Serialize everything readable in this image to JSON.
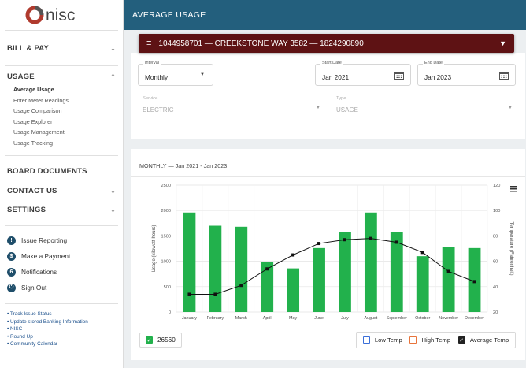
{
  "brand": {
    "logo_text": "nisc"
  },
  "header": {
    "title": "AVERAGE USAGE"
  },
  "account": {
    "label": "1044958701 — CREEKSTONE WAY 3582 — 1824290890"
  },
  "sidebar": {
    "bill_pay": "BILL & PAY",
    "usage": "USAGE",
    "usage_items": [
      "Average Usage",
      "Enter Meter Readings",
      "Usage Comparison",
      "Usage Explorer",
      "Usage Management",
      "Usage Tracking"
    ],
    "board_documents": "BOARD DOCUMENTS",
    "contact_us": "CONTACT US",
    "settings": "SETTINGS",
    "actions": [
      {
        "icon": "!",
        "label": "Issue Reporting"
      },
      {
        "icon": "$",
        "label": "Make a Payment"
      },
      {
        "icon": "6",
        "label": "Notifications"
      },
      {
        "icon": "⏻",
        "label": "Sign Out"
      }
    ],
    "links": [
      "Track Issue Status",
      "Update stored Banking Information",
      "NISC",
      "Round Up",
      "Community Calendar"
    ]
  },
  "filters": {
    "interval": {
      "label": "Interval",
      "value": "Monthly"
    },
    "start_date": {
      "label": "Start Date",
      "value": "Jan 2021"
    },
    "end_date": {
      "label": "End Date",
      "value": "Jan 2023"
    },
    "service": {
      "label": "Service",
      "value": "ELECTRIC"
    },
    "type": {
      "label": "Type",
      "value": "USAGE"
    }
  },
  "chart_title": "MONTHLY — Jan 2021 - Jan 2023",
  "total": "26560",
  "legend": {
    "low": "Low Temp",
    "high": "High Temp",
    "avg": "Average Temp"
  },
  "colors": {
    "bar": "#22b14c",
    "topbar": "#235f7d",
    "account_bar": "#5e1214",
    "low_temp": "#3b6fd8",
    "high_temp": "#e8743b"
  },
  "chart_data": {
    "type": "bar",
    "categories": [
      "January",
      "February",
      "March",
      "April",
      "May",
      "June",
      "July",
      "August",
      "September",
      "October",
      "November",
      "December"
    ],
    "series": [
      {
        "values": [
          1960,
          1700,
          1680,
          980,
          860,
          1260,
          1570,
          1960,
          1580,
          1100,
          1280,
          1260
        ]
      },
      {
        "values": [
          34,
          34,
          41,
          54,
          65,
          74,
          77,
          78,
          75,
          67,
          52,
          44
        ]
      }
    ],
    "ylabel": "Usage (kilowatt-hours)",
    "y2label": "Temperature (Fahrenheit)",
    "ylim": [
      0,
      2500
    ],
    "y2lim": [
      20,
      120
    ],
    "yticks": [
      "0",
      "500",
      "1000",
      "1500",
      "2000",
      "2500"
    ],
    "y2ticks": [
      "20",
      "40",
      "60",
      "80",
      "100",
      "120"
    ],
    "grid": true
  }
}
